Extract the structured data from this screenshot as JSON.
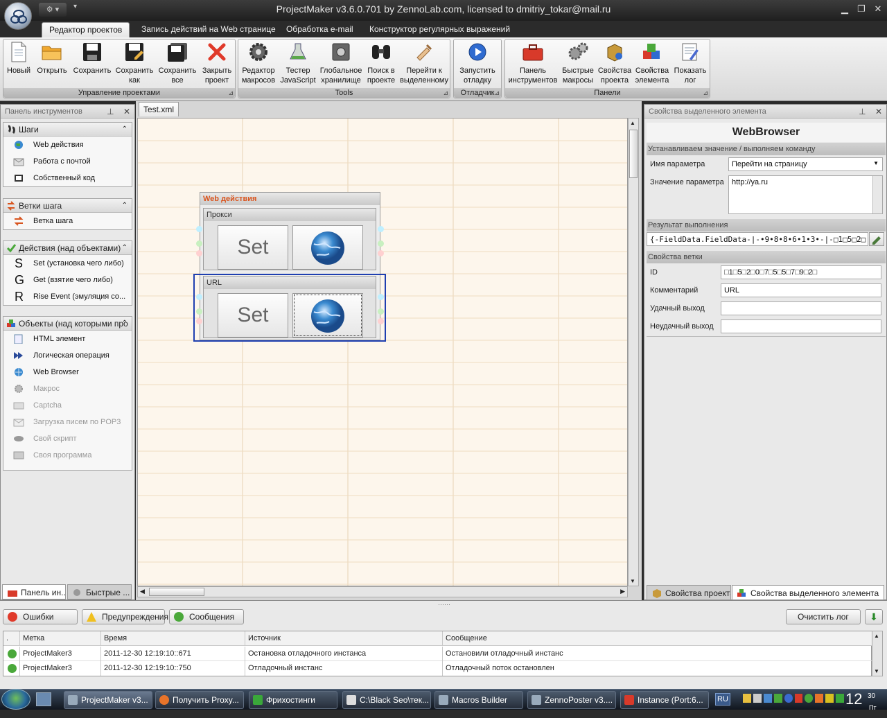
{
  "window": {
    "title": "ProjectMaker v3.6.0.701 by ZennoLab.com, licensed to dmitriy_tokar@mail.ru"
  },
  "ribbon_tabs": [
    {
      "label": "Редактор проектов"
    },
    {
      "label": "Запись действий на Web странице"
    },
    {
      "label": "Обработка e-mail"
    },
    {
      "label": "Конструктор регулярных выражений"
    }
  ],
  "groups": {
    "project": {
      "label": "Управление проектами",
      "buttons": [
        {
          "label": "Новый",
          "icon": "new-file-icon"
        },
        {
          "label": "Открыть",
          "icon": "open-folder-icon"
        },
        {
          "label": "Сохранить",
          "icon": "save-icon"
        },
        {
          "label": "Сохранить как",
          "icon": "save-as-icon"
        },
        {
          "label": "Сохранить все",
          "icon": "save-all-icon"
        },
        {
          "label": "Закрыть проект",
          "icon": "close-red-x-icon"
        }
      ]
    },
    "tools": {
      "label": "Tools",
      "buttons": [
        {
          "label": "Редактор макросов",
          "icon": "gear-icon"
        },
        {
          "label": "Тестер JavaScript",
          "icon": "flask-icon"
        },
        {
          "label": "Глобальное хранилище",
          "icon": "safe-icon"
        },
        {
          "label": "Поиск в проекте",
          "icon": "binoculars-icon"
        },
        {
          "label": "Перейти к выделенному",
          "icon": "pointer-hand-icon"
        }
      ]
    },
    "debug": {
      "label": "Отладчик",
      "buttons": [
        {
          "label": "Запустить отладку",
          "icon": "play-icon"
        }
      ]
    },
    "panels": {
      "label": "Панели",
      "buttons": [
        {
          "label": "Панель инструментов",
          "icon": "toolbox-icon"
        },
        {
          "label": "Быстрые макросы",
          "icon": "gears-icon"
        },
        {
          "label": "Свойства проекта",
          "icon": "box-icon"
        },
        {
          "label": "Свойства элемента",
          "icon": "cubes-icon"
        },
        {
          "label": "Показать лог",
          "icon": "log-icon"
        }
      ]
    }
  },
  "toolbox": {
    "title": "Панель инструментов",
    "sections": [
      {
        "title": "Шаги",
        "items": [
          {
            "label": "Web действия"
          },
          {
            "label": "Работа с почтой"
          },
          {
            "label": "Собственный код"
          }
        ]
      },
      {
        "title": "Ветки шага",
        "items": [
          {
            "label": "Ветка шага"
          }
        ]
      },
      {
        "title": "Действия (над объектами)",
        "items": [
          {
            "letter": "S",
            "label": "Set (установка чего либо)"
          },
          {
            "letter": "G",
            "label": "Get (взятие чего либо)"
          },
          {
            "letter": "R",
            "label": "Rise Event (эмуляция со..."
          }
        ]
      },
      {
        "title": "Объекты (над которыми про",
        "items": [
          {
            "label": "HTML элемент"
          },
          {
            "label": "Логическая операция"
          },
          {
            "label": "Web Browser"
          },
          {
            "label": "Макрос"
          },
          {
            "label": "Captcha"
          },
          {
            "label": "Загрузка писем по POP3"
          },
          {
            "label": "Свой скрипт"
          },
          {
            "label": "Своя программа"
          }
        ]
      }
    ],
    "bottom_tabs": [
      {
        "label": "Панель ин..."
      },
      {
        "label": "Быстрые ..."
      }
    ]
  },
  "document": {
    "tab": "Test.xml",
    "step": {
      "title": "Web действия",
      "branches": [
        {
          "title": "Прокси",
          "action": "Set"
        },
        {
          "title": "URL",
          "action": "Set"
        }
      ]
    }
  },
  "properties": {
    "title": "Свойства выделенного элемента",
    "element_name": "WebBrowser",
    "section1": "Устанавливаем значение / выполняем команду",
    "param_name_label": "Имя параметра",
    "param_name_value": "Перейти на страницу",
    "param_value_label": "Значение параметра",
    "param_value": "http://ya.ru",
    "result_section": "Результат выполнения",
    "result_value": "{-FieldData.FieldData-|-•9•8•8•6•1•3•-|-□1□5□2□",
    "branch_section": "Свойства ветки",
    "id_label": "ID",
    "id_value": "□1□5□2□0□7□5□5□7□9□2□",
    "comment_label": "Комментарий",
    "comment_value": "URL",
    "success_label": "Удачный выход",
    "success_value": "",
    "fail_label": "Неудачный выход",
    "fail_value": "",
    "bottom_tabs": [
      {
        "label": "Свойства проекта"
      },
      {
        "label": "Свойства выделенного элемента"
      }
    ]
  },
  "log": {
    "buttons": {
      "errors": "Ошибки",
      "warnings": "Предупреждения",
      "messages": "Сообщения",
      "clear": "Очистить лог"
    },
    "columns": [
      ".",
      "Метка",
      "Время",
      "Источник",
      "Сообщение"
    ],
    "rows": [
      {
        "tag": "ProjectMaker3",
        "time": "2011-12-30   12:19:10::671",
        "source": "Остановка отладочного инстанса",
        "message": "Остановили отладочный инстанс"
      },
      {
        "tag": "ProjectMaker3",
        "time": "2011-12-30   12:19:10::750",
        "source": "Отладочный инстанс",
        "message": "Отладочный поток остановлен"
      }
    ]
  },
  "taskbar": {
    "items": [
      {
        "label": "ProjectMaker v3..."
      },
      {
        "label": "Получить Proxy..."
      },
      {
        "label": "Фрихостинги"
      },
      {
        "label": "C:\\Black Seo\\тек..."
      },
      {
        "label": "Macros Builder"
      },
      {
        "label": "ZennoPoster v3...."
      },
      {
        "label": "Instance (Port:6..."
      }
    ],
    "lang": "RU",
    "clock_hour": "12",
    "clock_min": "30",
    "clock_day": "Пт"
  },
  "colors": {
    "accent_orange": "#d9541e",
    "selection_blue": "#1f3fb0",
    "canvas_bg": "#fdf6ec"
  }
}
